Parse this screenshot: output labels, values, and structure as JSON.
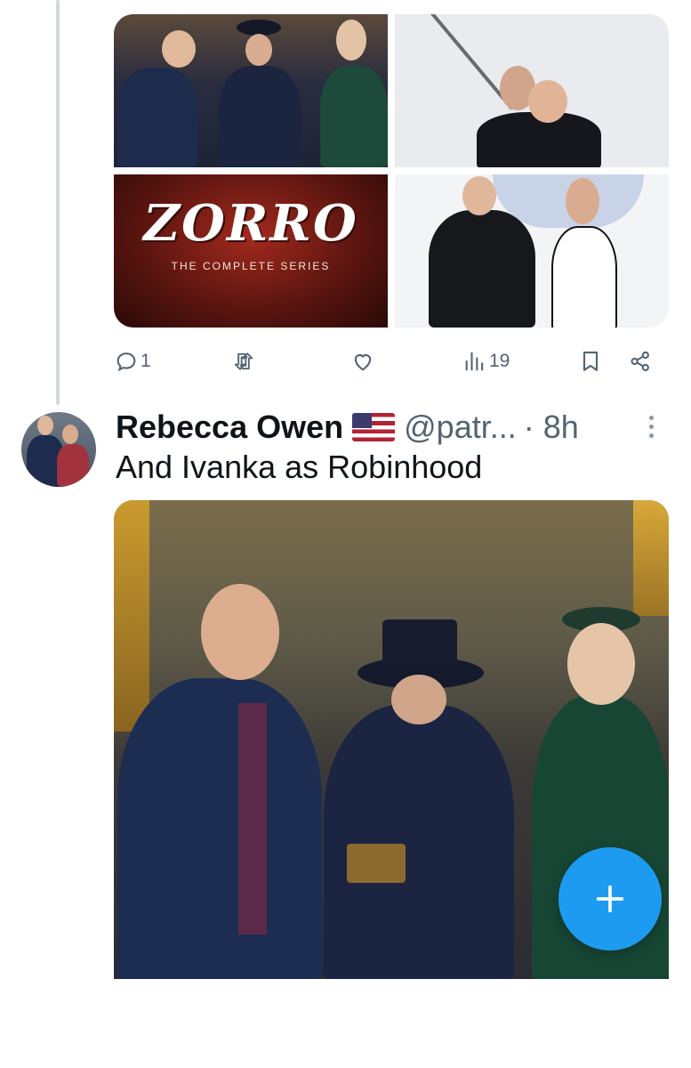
{
  "thread": {
    "media": [
      {
        "name": "inauguration-oath-thumbnail"
      },
      {
        "name": "sword-dance-thumbnail"
      },
      {
        "name": "zorro-cover-thumbnail",
        "title": "ZORRO",
        "subtitle": "THE COMPLETE SERIES"
      },
      {
        "name": "ball-photo-thumbnail"
      }
    ],
    "actions": {
      "reply_count": "1",
      "retweet_count": "",
      "like_count": "",
      "views_count": "19"
    }
  },
  "reply": {
    "name": "Rebecca Owen",
    "flag": "us-flag-emoji",
    "handle": "@patr...",
    "time": "· 8h",
    "text": "And Ivanka as Robinhood"
  },
  "colors": {
    "accent": "#1d9bf0",
    "muted": "#536471",
    "thread_line": "#cfd9de"
  },
  "icons": [
    "reply-icon",
    "retweet-icon",
    "like-icon",
    "views-icon",
    "bookmark-icon",
    "share-icon",
    "more-icon",
    "compose-plus-icon"
  ]
}
